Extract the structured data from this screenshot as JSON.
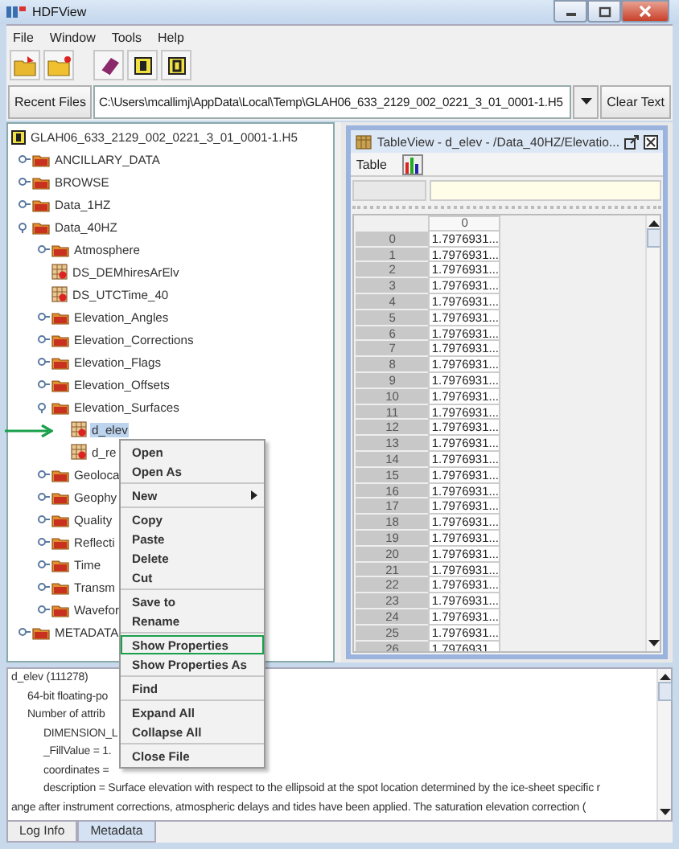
{
  "window": {
    "title": "HDFView"
  },
  "menu": [
    "File",
    "Window",
    "Tools",
    "Help"
  ],
  "recent_files": {
    "button": "Recent Files",
    "value": "C:\\Users\\mcallimj\\AppData\\Local\\Temp\\GLAH06_633_2129_002_0221_3_01_0001-1.H5",
    "clear_button": "Clear Text"
  },
  "tree": {
    "label": "GLAH06_633_2129_002_0221_3_01_0001-1.H5",
    "kind": "file",
    "selected": false,
    "marked": false,
    "children": [
      {
        "label": "ANCILLARY_DATA",
        "kind": "group",
        "expanded": false,
        "selected": false,
        "marked": false
      },
      {
        "label": "BROWSE",
        "kind": "group",
        "expanded": false,
        "selected": false,
        "marked": false
      },
      {
        "label": "Data_1HZ",
        "kind": "group",
        "expanded": false,
        "selected": false,
        "marked": false
      },
      {
        "label": "Data_40HZ",
        "kind": "group",
        "expanded": true,
        "selected": false,
        "marked": false,
        "children": [
          {
            "label": "Atmosphere",
            "kind": "group",
            "expanded": false,
            "selected": false,
            "marked": false
          },
          {
            "label": "DS_DEMhiresArElv",
            "kind": "dataset",
            "selected": false,
            "marked": false
          },
          {
            "label": "DS_UTCTime_40",
            "kind": "dataset",
            "selected": false,
            "marked": false
          },
          {
            "label": "Elevation_Angles",
            "kind": "group",
            "expanded": false,
            "selected": false,
            "marked": false
          },
          {
            "label": "Elevation_Corrections",
            "kind": "group",
            "expanded": false,
            "selected": false,
            "marked": false
          },
          {
            "label": "Elevation_Flags",
            "kind": "group",
            "expanded": false,
            "selected": false,
            "marked": false
          },
          {
            "label": "Elevation_Offsets",
            "kind": "group",
            "expanded": false,
            "selected": false,
            "marked": false
          },
          {
            "label": "Elevation_Surfaces",
            "kind": "group",
            "expanded": true,
            "selected": false,
            "marked": false,
            "children": [
              {
                "label": "d_elev",
                "kind": "dataset",
                "selected": true,
                "marked": true
              },
              {
                "label": "d_re",
                "kind": "dataset",
                "selected": false,
                "marked": false
              }
            ]
          },
          {
            "label": "Geoloca",
            "kind": "group",
            "expanded": false,
            "selected": false,
            "marked": false
          },
          {
            "label": "Geophy",
            "kind": "group",
            "expanded": false,
            "selected": false,
            "marked": false
          },
          {
            "label": "Quality",
            "kind": "group",
            "expanded": false,
            "selected": false,
            "marked": false
          },
          {
            "label": "Reflecti",
            "kind": "group",
            "expanded": false,
            "selected": false,
            "marked": false
          },
          {
            "label": "Time",
            "kind": "group",
            "expanded": false,
            "selected": false,
            "marked": false
          },
          {
            "label": "Transm",
            "kind": "group",
            "expanded": false,
            "selected": false,
            "marked": false
          },
          {
            "label": "Wavefor",
            "kind": "group",
            "expanded": false,
            "selected": false,
            "marked": false
          }
        ]
      },
      {
        "label": "METADATA",
        "kind": "group",
        "expanded": false,
        "selected": false,
        "marked": false
      }
    ]
  },
  "table_view": {
    "title": "TableView - d_elev - /Data_40HZ/Elevatio...",
    "menu": [
      "Table"
    ],
    "column_header": "0",
    "rows": [
      {
        "index": "0",
        "value": "1.7976931..."
      },
      {
        "index": "1",
        "value": "1.7976931..."
      },
      {
        "index": "2",
        "value": "1.7976931..."
      },
      {
        "index": "3",
        "value": "1.7976931..."
      },
      {
        "index": "4",
        "value": "1.7976931..."
      },
      {
        "index": "5",
        "value": "1.7976931..."
      },
      {
        "index": "6",
        "value": "1.7976931..."
      },
      {
        "index": "7",
        "value": "1.7976931..."
      },
      {
        "index": "8",
        "value": "1.7976931..."
      },
      {
        "index": "9",
        "value": "1.7976931..."
      },
      {
        "index": "10",
        "value": "1.7976931..."
      },
      {
        "index": "11",
        "value": "1.7976931..."
      },
      {
        "index": "12",
        "value": "1.7976931..."
      },
      {
        "index": "13",
        "value": "1.7976931..."
      },
      {
        "index": "14",
        "value": "1.7976931..."
      },
      {
        "index": "15",
        "value": "1.7976931..."
      },
      {
        "index": "16",
        "value": "1.7976931..."
      },
      {
        "index": "17",
        "value": "1.7976931..."
      },
      {
        "index": "18",
        "value": "1.7976931..."
      },
      {
        "index": "19",
        "value": "1.7976931..."
      },
      {
        "index": "20",
        "value": "1.7976931..."
      },
      {
        "index": "21",
        "value": "1.7976931..."
      },
      {
        "index": "22",
        "value": "1.7976931..."
      },
      {
        "index": "23",
        "value": "1.7976931..."
      },
      {
        "index": "24",
        "value": "1.7976931..."
      },
      {
        "index": "25",
        "value": "1.7976931..."
      },
      {
        "index": "26",
        "value": "1.7976931..."
      }
    ]
  },
  "context_menu": {
    "items": [
      {
        "kind": "item",
        "label": "Open",
        "highlighted": false
      },
      {
        "kind": "item",
        "label": "Open As",
        "highlighted": false
      },
      {
        "kind": "separator"
      },
      {
        "kind": "submenu",
        "label": "New",
        "highlighted": false
      },
      {
        "kind": "separator"
      },
      {
        "kind": "item",
        "label": "Copy",
        "highlighted": false
      },
      {
        "kind": "item",
        "label": "Paste",
        "highlighted": false
      },
      {
        "kind": "item",
        "label": "Delete",
        "highlighted": false
      },
      {
        "kind": "item",
        "label": "Cut",
        "highlighted": false
      },
      {
        "kind": "separator"
      },
      {
        "kind": "item",
        "label": "Save to",
        "highlighted": false
      },
      {
        "kind": "item",
        "label": "Rename",
        "highlighted": false
      },
      {
        "kind": "separator"
      },
      {
        "kind": "item",
        "label": "Show Properties",
        "highlighted": true
      },
      {
        "kind": "item",
        "label": "Show Properties As",
        "highlighted": false
      },
      {
        "kind": "separator"
      },
      {
        "kind": "item",
        "label": "Find",
        "highlighted": false
      },
      {
        "kind": "separator"
      },
      {
        "kind": "item",
        "label": "Expand All",
        "highlighted": false
      },
      {
        "kind": "item",
        "label": "Collapse All",
        "highlighted": false
      },
      {
        "kind": "separator"
      },
      {
        "kind": "item",
        "label": "Close File",
        "highlighted": false
      }
    ]
  },
  "metadata": {
    "lines": [
      {
        "text": "d_elev (111278)",
        "children": [
          {
            "text": "64-bit floating-po"
          },
          {
            "text": "Number of attrib",
            "children": [
              {
                "text": "DIMENSION_L"
              },
              {
                "text": "_FillValue = 1."
              },
              {
                "text": "coordinates ="
              },
              {
                "text": "description = Surface elevation with respect to the ellipsoid at the spot location determined by the ice-sheet specific r"
              }
            ]
          }
        ]
      },
      {
        "text": "ange after instrument corrections, atmospheric delays and tides have been applied. The saturation elevation correction ("
      }
    ]
  },
  "tabs": [
    {
      "label": "Log Info",
      "selected": false
    },
    {
      "label": "Metadata",
      "selected": true
    }
  ]
}
